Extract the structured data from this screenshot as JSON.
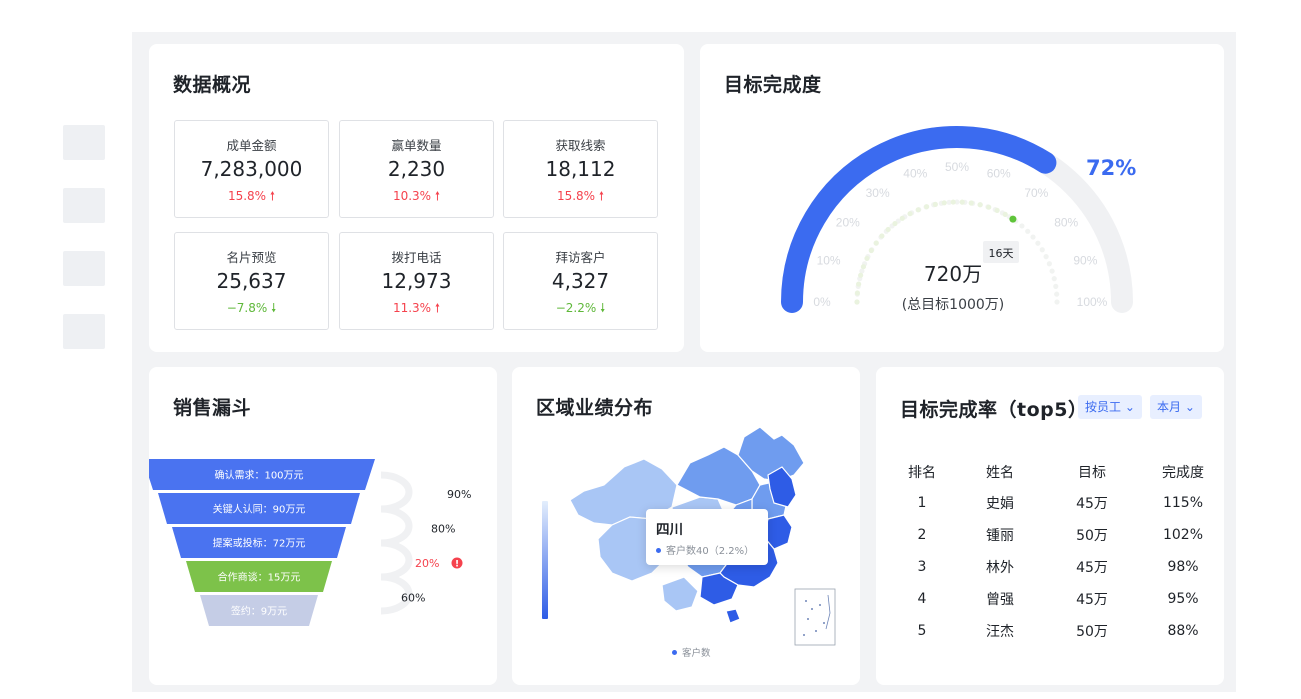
{
  "overview": {
    "title": "数据概况",
    "kpis": [
      {
        "label": "成单金额",
        "value": "7,283,000",
        "change": "15.8%",
        "direction": "up"
      },
      {
        "label": "赢单数量",
        "value": "2,230",
        "change": "10.3%",
        "direction": "up"
      },
      {
        "label": "获取线索",
        "value": "18,112",
        "change": "15.8%",
        "direction": "up"
      },
      {
        "label": "名片预览",
        "value": "25,637",
        "change": "−7.8%",
        "direction": "down"
      },
      {
        "label": "拨打电话",
        "value": "12,973",
        "change": "11.3%",
        "direction": "up"
      },
      {
        "label": "拜访客户",
        "value": "4,327",
        "change": "−2.2%",
        "direction": "down"
      }
    ],
    "up_arrow": "🠕",
    "down_arrow": "🠗"
  },
  "gauge": {
    "title": "目标完成度",
    "percent_label": "72%",
    "percent": 72,
    "progress_percent": 68,
    "center_value": "720万",
    "center_sub": "(总目标1000万)",
    "days_badge": "16天",
    "scale": [
      "0%",
      "10%",
      "20%",
      "30%",
      "40%",
      "50%",
      "60%",
      "70%",
      "80%",
      "90%",
      "100%"
    ],
    "colors": {
      "arc": "#3b6bf0",
      "track": "#f0f1f3",
      "percent_text": "#3b6bf0",
      "dot": "#5fc43a"
    }
  },
  "funnel": {
    "title": "销售漏斗",
    "stages": [
      {
        "label": "确认需求：100万元",
        "color": "#4a73f0"
      },
      {
        "label": "关键人认同：90万元",
        "color": "#4a73f0"
      },
      {
        "label": "提案或投标：72万元",
        "color": "#4a73f0"
      },
      {
        "label": "合作商谈：15万元",
        "color": "#7dc24a"
      },
      {
        "label": "签约：9万元",
        "color": "#c5cde6"
      }
    ],
    "rates": [
      {
        "label": "90%",
        "alert": false
      },
      {
        "label": "80%",
        "alert": false
      },
      {
        "label": "20%",
        "alert": true
      },
      {
        "label": "60%",
        "alert": false
      }
    ]
  },
  "map": {
    "title": "区域业绩分布",
    "tooltip": {
      "region": "四川",
      "metric_label": "客户数40（2.2%）"
    },
    "legend_label": "客户数",
    "colors": {
      "light": "#a9c6f5",
      "mid": "#6f9cef",
      "dark": "#2e5ce6"
    }
  },
  "ranking": {
    "title": "目标完成率（top5）",
    "filters": [
      {
        "label": "按员工"
      },
      {
        "label": "本月"
      }
    ],
    "columns": [
      "排名",
      "姓名",
      "目标",
      "完成度"
    ],
    "rows": [
      [
        "1",
        "史娟",
        "45万",
        "115%"
      ],
      [
        "2",
        "锺丽",
        "50万",
        "102%"
      ],
      [
        "3",
        "林外",
        "45万",
        "98%"
      ],
      [
        "4",
        "曾强",
        "45万",
        "95%"
      ],
      [
        "5",
        "汪杰",
        "50万",
        "88%"
      ]
    ]
  }
}
